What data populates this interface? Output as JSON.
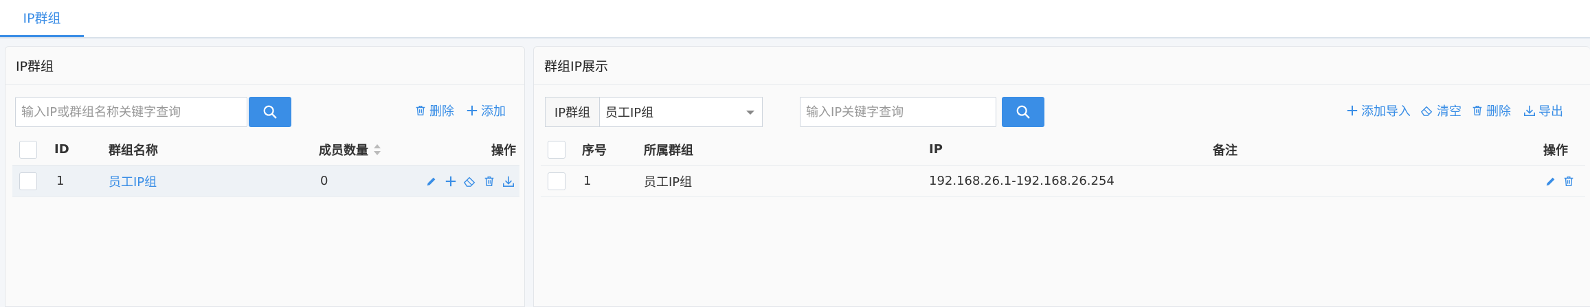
{
  "tabs": [
    {
      "label": "IP群组"
    }
  ],
  "left_panel": {
    "title": "IP群组",
    "search_placeholder": "输入IP或群组名称关键字查询",
    "delete_label": "删除",
    "add_label": "添加",
    "columns": {
      "id": "ID",
      "name": "群组名称",
      "count": "成员数量",
      "ops": "操作"
    },
    "rows": [
      {
        "id": "1",
        "name": "员工IP组",
        "count": "0"
      }
    ]
  },
  "right_panel": {
    "title": "群组IP展示",
    "group_addon": "IP群组",
    "group_selected": "员工IP组",
    "search_placeholder": "输入IP关键字查询",
    "add_import_label": "添加导入",
    "clear_label": "清空",
    "delete_label": "删除",
    "export_label": "导出",
    "columns": {
      "seq": "序号",
      "group": "所属群组",
      "ip": "IP",
      "note": "备注",
      "ops": "操作"
    },
    "rows": [
      {
        "seq": "1",
        "group": "员工IP组",
        "ip": "192.168.26.1-192.168.26.254",
        "note": ""
      }
    ]
  },
  "colors": {
    "accent": "#3a8ee6",
    "panel_bg": "#fafafa",
    "row_highlight": "#eef2f6"
  },
  "icons": [
    "search-icon",
    "trash-icon",
    "plus-icon",
    "edit-icon",
    "eraser-icon",
    "download-icon",
    "sort-icon",
    "chevron-down-icon"
  ]
}
